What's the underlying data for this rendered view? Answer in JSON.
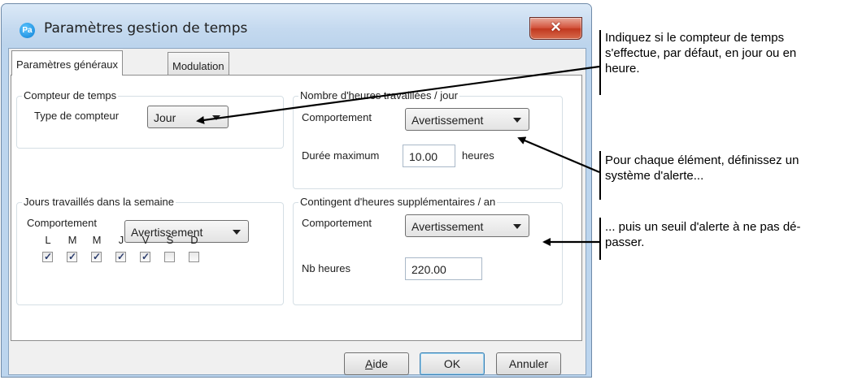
{
  "window": {
    "title": "Paramètres gestion de temps",
    "icon_text": "Pa",
    "close_glyph": "✕"
  },
  "tabs": [
    {
      "label": "Paramètres généraux",
      "active": true
    },
    {
      "label": "Modulation",
      "active": false
    }
  ],
  "counter": {
    "legend": "Compteur de temps",
    "type_label": "Type de compteur",
    "type_value": "Jour"
  },
  "hours_per_day": {
    "legend": "Nombre d'heures travaillées / jour",
    "behavior_label": "Comportement",
    "behavior_value": "Avertissement",
    "max_label": "Durée maximum",
    "max_value": "10.00",
    "max_unit": "heures"
  },
  "workdays": {
    "legend": "Jours travaillés dans la semaine",
    "behavior_label": "Comportement",
    "behavior_value": "Avertissement",
    "days": [
      {
        "label": "L",
        "checked": true
      },
      {
        "label": "M",
        "checked": true
      },
      {
        "label": "M",
        "checked": true
      },
      {
        "label": "J",
        "checked": true
      },
      {
        "label": "V",
        "checked": true
      },
      {
        "label": "S",
        "checked": false
      },
      {
        "label": "D",
        "checked": false
      }
    ]
  },
  "overtime": {
    "legend": "Contingent d'heures supplémentaires / an",
    "behavior_label": "Comportement",
    "behavior_value": "Avertissement",
    "hours_label": "Nb heures",
    "hours_value": "220.00"
  },
  "buttons": {
    "help_accel": "A",
    "help_rest": "ide",
    "ok": "OK",
    "cancel": "Annuler"
  },
  "annotations": {
    "counter_type": [
      "Indiquez si le compteur de temps",
      "s'effectue, par défaut, en jour ou en",
      "heure."
    ],
    "alert_system": [
      "Pour chaque élément, définissez un",
      "système d'alerte..."
    ],
    "alert_threshold": [
      "... puis un seuil d'alerte à ne pas dé-",
      "passer."
    ]
  },
  "colors": {
    "titlebar": "#c4d9ef",
    "close_button": "#c1381f",
    "checkbox_check": "#2b3c6c"
  }
}
